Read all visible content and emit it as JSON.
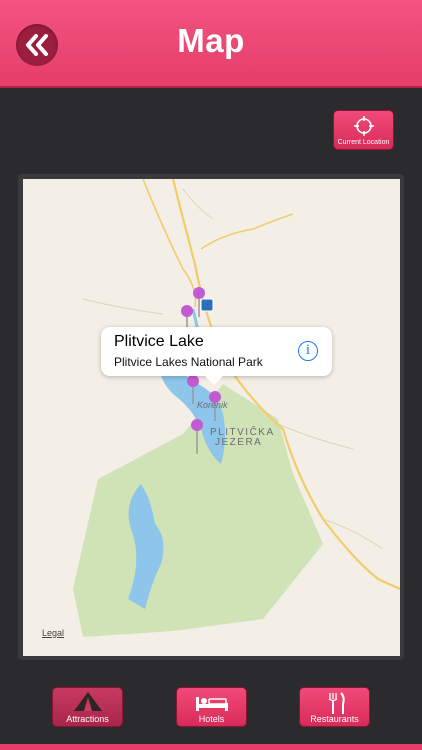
{
  "header": {
    "title": "Map"
  },
  "current_location": {
    "label": "Current Location"
  },
  "map": {
    "callout": {
      "title": "Plitvice Lake",
      "subtitle": "Plitvice Lakes National Park",
      "info_glyph": "i"
    },
    "labels": {
      "town": "Korenik",
      "park_line1": "PLITVIČKA",
      "park_line2": "JEZERA"
    },
    "legal": "Legal",
    "colors": {
      "land": "#f3efe6",
      "park": "#cfe3b7",
      "water": "#8ec5ea",
      "road": "#f2cc6b",
      "pin": "#c25bd3"
    }
  },
  "tabs": [
    {
      "label": "Attractions",
      "icon": "tent-icon",
      "active": true
    },
    {
      "label": "Hotels",
      "icon": "bed-icon",
      "active": false
    },
    {
      "label": "Restaurants",
      "icon": "fork-knife-icon",
      "active": false
    }
  ],
  "theme": {
    "accent": "#e63d6b",
    "background": "#2b2a2d"
  }
}
